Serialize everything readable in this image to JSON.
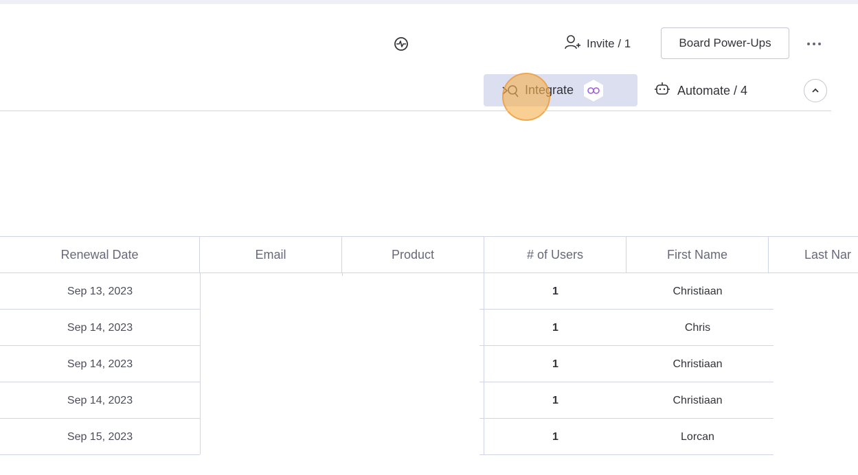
{
  "toolbar": {
    "activity_icon": "activity-icon",
    "invite_label": "Invite / 1",
    "power_ups_label": "Board Power-Ups",
    "more_icon": "more-dots-icon",
    "integrate_label": "Integrate",
    "automate_label": "Automate / 4",
    "collapse_icon": "chevron-up-icon"
  },
  "table": {
    "columns": [
      "Renewal Date",
      "Email",
      "Product",
      "# of Users",
      "First Name",
      "Last Nar"
    ],
    "rows": [
      {
        "renewal_date": "Sep 13, 2023",
        "users": "1",
        "first_name": "Christiaan"
      },
      {
        "renewal_date": "Sep 14, 2023",
        "users": "1",
        "first_name": "Chris"
      },
      {
        "renewal_date": "Sep 14, 2023",
        "users": "1",
        "first_name": "Christiaan"
      },
      {
        "renewal_date": "Sep 14, 2023",
        "users": "1",
        "first_name": "Christiaan"
      },
      {
        "renewal_date": "Sep 15, 2023",
        "users": "1",
        "first_name": "Lorcan"
      }
    ]
  },
  "colors": {
    "page_bg": "#eef0f8",
    "integrate_bg": "#dcdff0",
    "border": "#d0d4e4",
    "integration_badge": "#a25ddc",
    "cursor_highlight": "#f6b250"
  }
}
